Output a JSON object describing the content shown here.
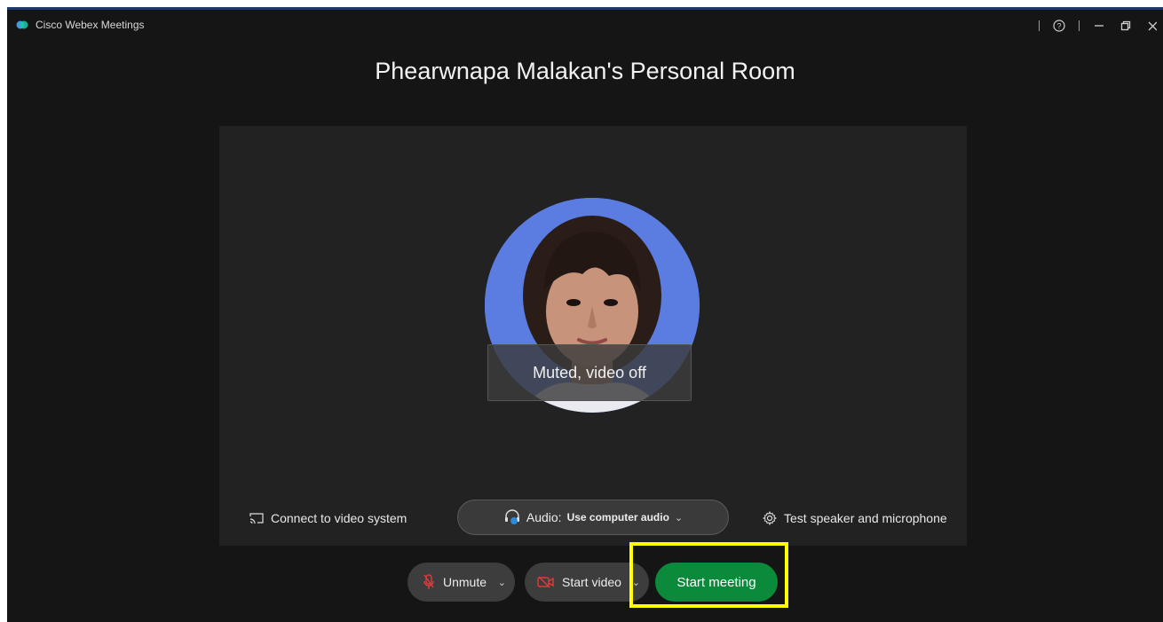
{
  "app": {
    "title": "Cisco Webex Meetings"
  },
  "room": {
    "title": "Phearwnapa Malakan's Personal Room"
  },
  "preview": {
    "status": "Muted, video off"
  },
  "options": {
    "connect_label": "Connect to video system",
    "audio_prefix": "Audio:",
    "audio_value": "Use computer audio",
    "test_label": "Test speaker and microphone"
  },
  "controls": {
    "unmute_label": "Unmute",
    "video_label": "Start video",
    "start_label": "Start meeting"
  },
  "colors": {
    "start_button": "#0a8a3a",
    "highlight": "#ffff00",
    "avatar_bg": "#5b7ce0",
    "muted_icon": "#e23b3b"
  },
  "icons": [
    "webex-logo-icon",
    "help-icon",
    "minimize-icon",
    "restore-icon",
    "close-icon",
    "cast-icon",
    "headset-icon",
    "gear-icon",
    "microphone-muted-icon",
    "video-off-icon",
    "chevron-down-icon"
  ]
}
